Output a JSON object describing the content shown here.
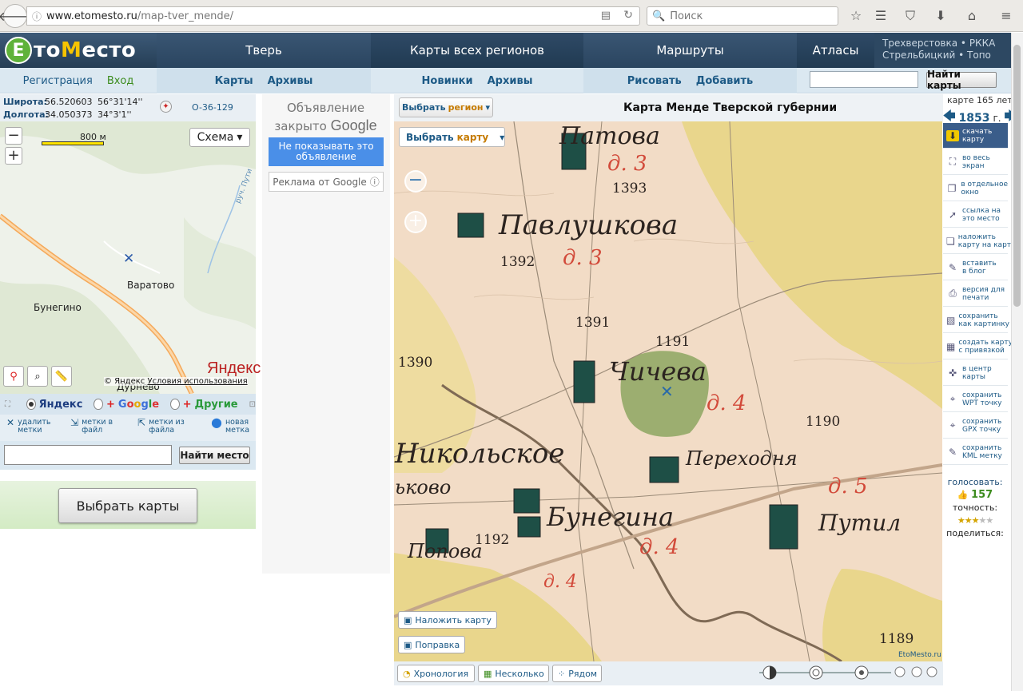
{
  "browser": {
    "url_host": "www.etomesto.ru",
    "url_path": "/map-tver_mende/",
    "search_placeholder": "Поиск"
  },
  "site": {
    "logo_e": "Е",
    "logo_to": "то",
    "logo_m": "М",
    "logo_esto": "есто",
    "nav": {
      "tver": "Тверь",
      "regions": "Карты всех регионов",
      "routes": "Маршруты",
      "atlas": "Атласы",
      "extra_line1": "Трехверстовка • РККА",
      "extra_line2": "Стрельбицкий • Топо"
    },
    "subnav": {
      "register": "Регистрация",
      "login": "Вход",
      "tver_maps": "Карты",
      "tver_archives": "Архивы",
      "regions_new": "Новинки",
      "regions_archives": "Архивы",
      "routes_draw": "Рисовать",
      "routes_add": "Добавить",
      "find_maps_btn": "Найти карты"
    }
  },
  "left": {
    "lat_label": "Широта:",
    "lat_dec": "56.520603",
    "lat_dms": "56°31'14''",
    "lon_label": "Долгота:",
    "lon_dec": "34.050373",
    "lon_dms": "34°3'1''",
    "sheet_code": "O-36-129",
    "scale_label": "800 м",
    "scheme_btn": "Схема",
    "places": {
      "varatovo": "Варатово",
      "bunegino": "Бунегино",
      "durnevo": "Дурнево",
      "road": "руч. Пути"
    },
    "yandex_logo": "Яндекс",
    "yandex_copy": "© Яндекс",
    "yandex_terms": "Условия использования",
    "sources": {
      "yandex": "Яндекс",
      "google_plus": "+",
      "google_g": "G",
      "google_o1": "o",
      "google_o2": "o",
      "google_g2": "g",
      "google_l": "l",
      "google_e": "e",
      "others_plus": "+",
      "others": "Другие"
    },
    "marks": {
      "delete": "удалить\nметки",
      "to_file": "метки в\nфайл",
      "from_file": "метки из\nфайла",
      "new": "новая\nметка"
    },
    "find_place_btn": "Найти место",
    "choose_maps_btn": "Выбрать карты"
  },
  "ad": {
    "closed_line1": "Объявление",
    "closed_line2": "закрыто",
    "google": "Google",
    "hide_btn": "Не показывать это объявление",
    "by_google": "Реклама от Google"
  },
  "main": {
    "choose_region_a": "Выбрать ",
    "choose_region_b": "регион",
    "title": "Карта Менде Тверской губернии",
    "age_label": "карте 165 лет",
    "year": "1853",
    "year_suffix": "г.",
    "choose_map_a": "Выбрать ",
    "choose_map_b": "карту",
    "overlay_btn": "Наложить карту",
    "correction_btn": "Поправка",
    "chronology_btn": "Хронология",
    "several_btn": "Несколько",
    "nearby_btn": "Рядом",
    "watermark": "EtoMesto.ru",
    "map_labels": {
      "patova": "Патова",
      "pavlushkova": "Павлушкова",
      "chicheva": "Чичева",
      "nikolskoe": "Никольское",
      "perekhodnya": "Переходня",
      "bunegina": "Бунегина",
      "popova": "Попова",
      "putil": "Путил",
      "nikovo": "ьково",
      "d3a": "д. 3",
      "d3b": "д. 3",
      "d4a": "д. 4",
      "d4b": "д. 4",
      "d4c": "д. 4",
      "d5": "д. 5",
      "n1393": "1393",
      "n1392": "1392",
      "n1391": "1391",
      "n1390": "1390",
      "n1191": "1191",
      "n1190": "1190",
      "n1192": "1192",
      "n1189": "1189"
    }
  },
  "tools": [
    {
      "label": "скачать\nкарту",
      "icon": "download-icon"
    },
    {
      "label": "во весь\nэкран",
      "icon": "fullscreen-icon"
    },
    {
      "label": "в отдельное\nокно",
      "icon": "new-window-icon"
    },
    {
      "label": "ссылка на\nэто место",
      "icon": "cursor-icon"
    },
    {
      "label": "наложить\nкарту на карту",
      "icon": "overlay-icon"
    },
    {
      "label": "вставить\nв блог",
      "icon": "pencil-icon"
    },
    {
      "label": "версия для\nпечати",
      "icon": "printer-icon"
    },
    {
      "label": "сохранить\nкак картинку",
      "icon": "save-image-icon"
    },
    {
      "label": "создать карту\nс привязкой",
      "icon": "grid-icon"
    },
    {
      "label": "в центр\nкарты",
      "icon": "crosshair-icon"
    },
    {
      "label": "сохранить\nWPT точку",
      "icon": "wpt-icon"
    },
    {
      "label": "сохранить\nGPX точку",
      "icon": "gpx-icon"
    },
    {
      "label": "сохранить\nKML метку",
      "icon": "kml-icon"
    }
  ],
  "vote": {
    "label": "голосовать:",
    "count": "157",
    "accuracy": "точность:",
    "rating": 3,
    "rating_max": 5,
    "share": "поделиться:"
  },
  "colors": {
    "header": "#2f4a62",
    "link": "#1d5a86",
    "green": "#3c8c1e",
    "map_paper": "#f2dcc6",
    "map_yellow": "#e9d68c",
    "map_green": "#9cae70"
  }
}
